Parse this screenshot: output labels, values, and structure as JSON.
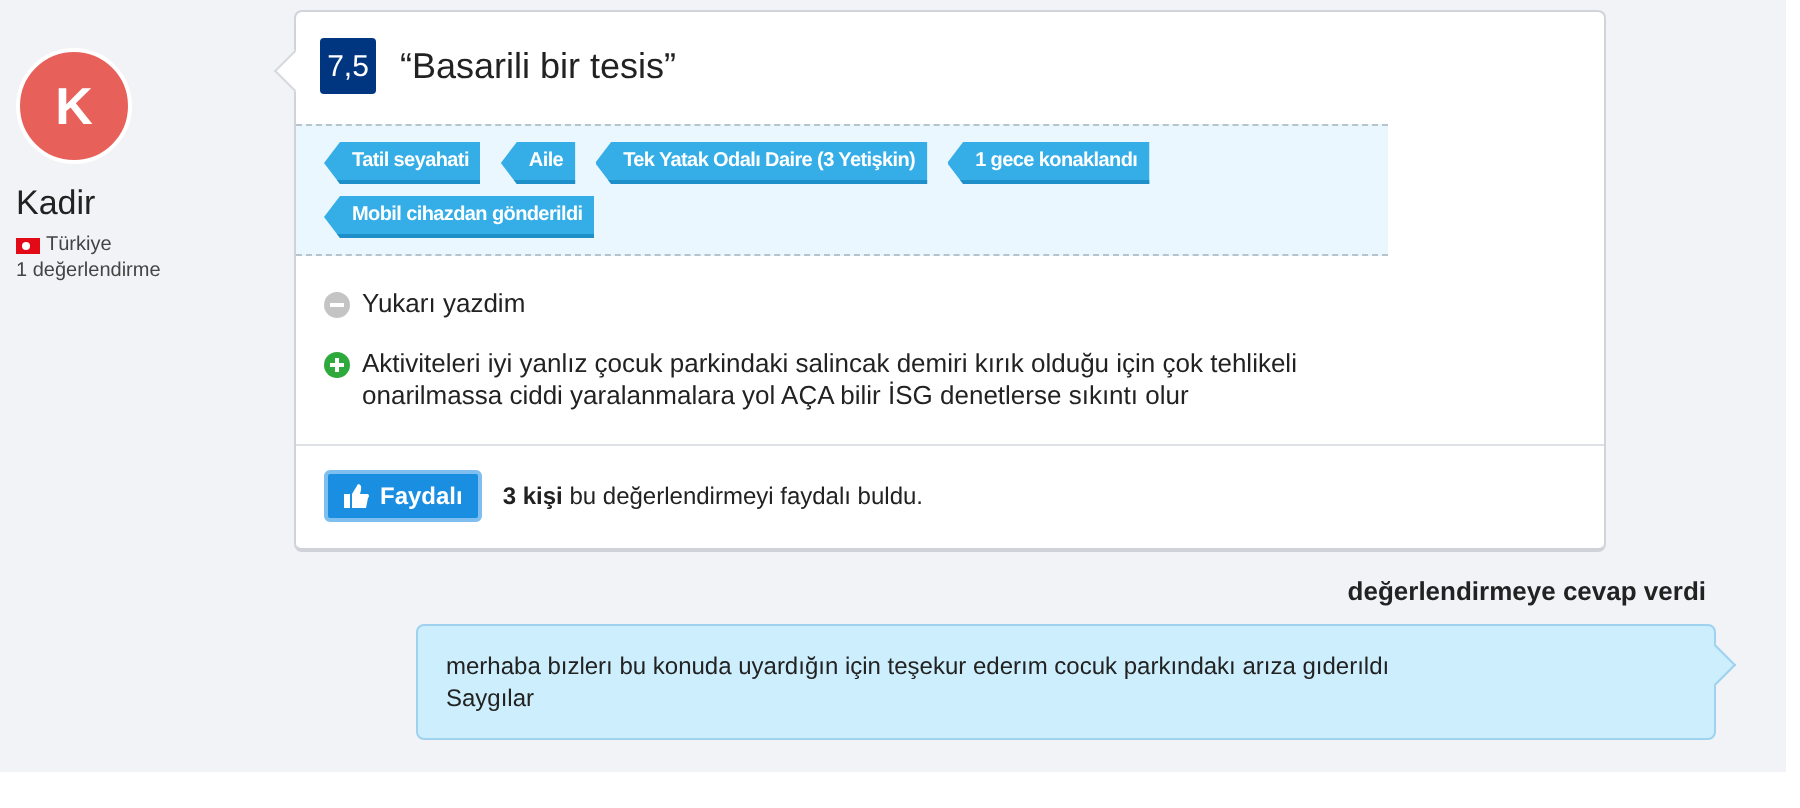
{
  "reviewer": {
    "initial": "K",
    "name": "Kadir",
    "country": "Türkiye",
    "review_count": "1 değerlendirme"
  },
  "review": {
    "score": "7,5",
    "title": "“Basarili bir tesis”",
    "tags": [
      "Tatil seyahati",
      "Aile",
      "Tek Yatak Odalı Daire (3 Yetişkin)",
      "1 gece konaklandı",
      "Mobil cihazdan gönderildi"
    ],
    "comments": [
      {
        "kind": "negative",
        "text": "Yukarı yazdim"
      },
      {
        "kind": "positive",
        "text": "Aktiviteleri iyi yanlız çocuk parkindaki salincak demiri kırık olduğu için çok tehlikeli onarilmassa ciddi yaralanmalara yol AÇA bilir İSG denetlerse sıkıntı olur"
      }
    ],
    "helpful_button": "Faydalı",
    "helpful_text": "**3 kişi** bu değerlendirmeyi faydalı buldu."
  },
  "reply": {
    "heading": "değerlendirmeye cevap verdi",
    "lines": [
      "merhaba bızlerı bu konuda uyardığın için teşekur ederım cocuk parkındakı arıza gıderıldı",
      "Saygılar"
    ]
  }
}
